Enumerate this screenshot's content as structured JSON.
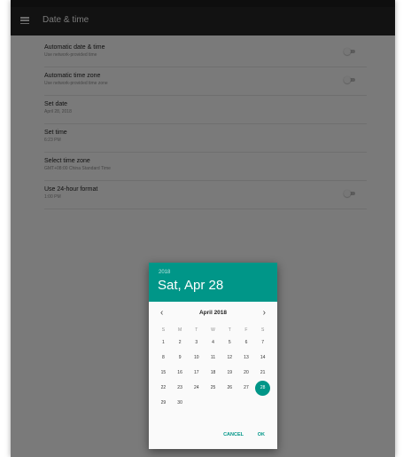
{
  "appbar": {
    "title": "Date & time"
  },
  "settings": [
    {
      "title": "Automatic date & time",
      "subtitle": "Use network-provided time",
      "toggle": "off"
    },
    {
      "title": "Automatic time zone",
      "subtitle": "Use network-provided time zone",
      "toggle": "off"
    },
    {
      "title": "Set date",
      "subtitle": "April 28, 2018"
    },
    {
      "title": "Set time",
      "subtitle": "6:23 PM"
    },
    {
      "title": "Select time zone",
      "subtitle": "GMT+08:00 China Standard Time"
    },
    {
      "title": "Use 24-hour format",
      "subtitle": "1:00 PM",
      "toggle": "off"
    }
  ],
  "dialog": {
    "year": "2018",
    "date": "Sat, Apr 28",
    "month_label": "April 2018",
    "weekdays": [
      "S",
      "M",
      "T",
      "W",
      "T",
      "F",
      "S"
    ],
    "weeks": [
      [
        "1",
        "2",
        "3",
        "4",
        "5",
        "6",
        "7"
      ],
      [
        "8",
        "9",
        "10",
        "11",
        "12",
        "13",
        "14"
      ],
      [
        "15",
        "16",
        "17",
        "18",
        "19",
        "20",
        "21"
      ],
      [
        "22",
        "23",
        "24",
        "25",
        "26",
        "27",
        "28"
      ],
      [
        "29",
        "30",
        "",
        "",
        "",
        "",
        ""
      ]
    ],
    "selected_day": "28",
    "cancel_label": "CANCEL",
    "ok_label": "OK",
    "accent_color": "#009688"
  },
  "icons": {
    "menu": "menu-icon",
    "prev": "chevron-left-icon",
    "next": "chevron-right-icon"
  }
}
